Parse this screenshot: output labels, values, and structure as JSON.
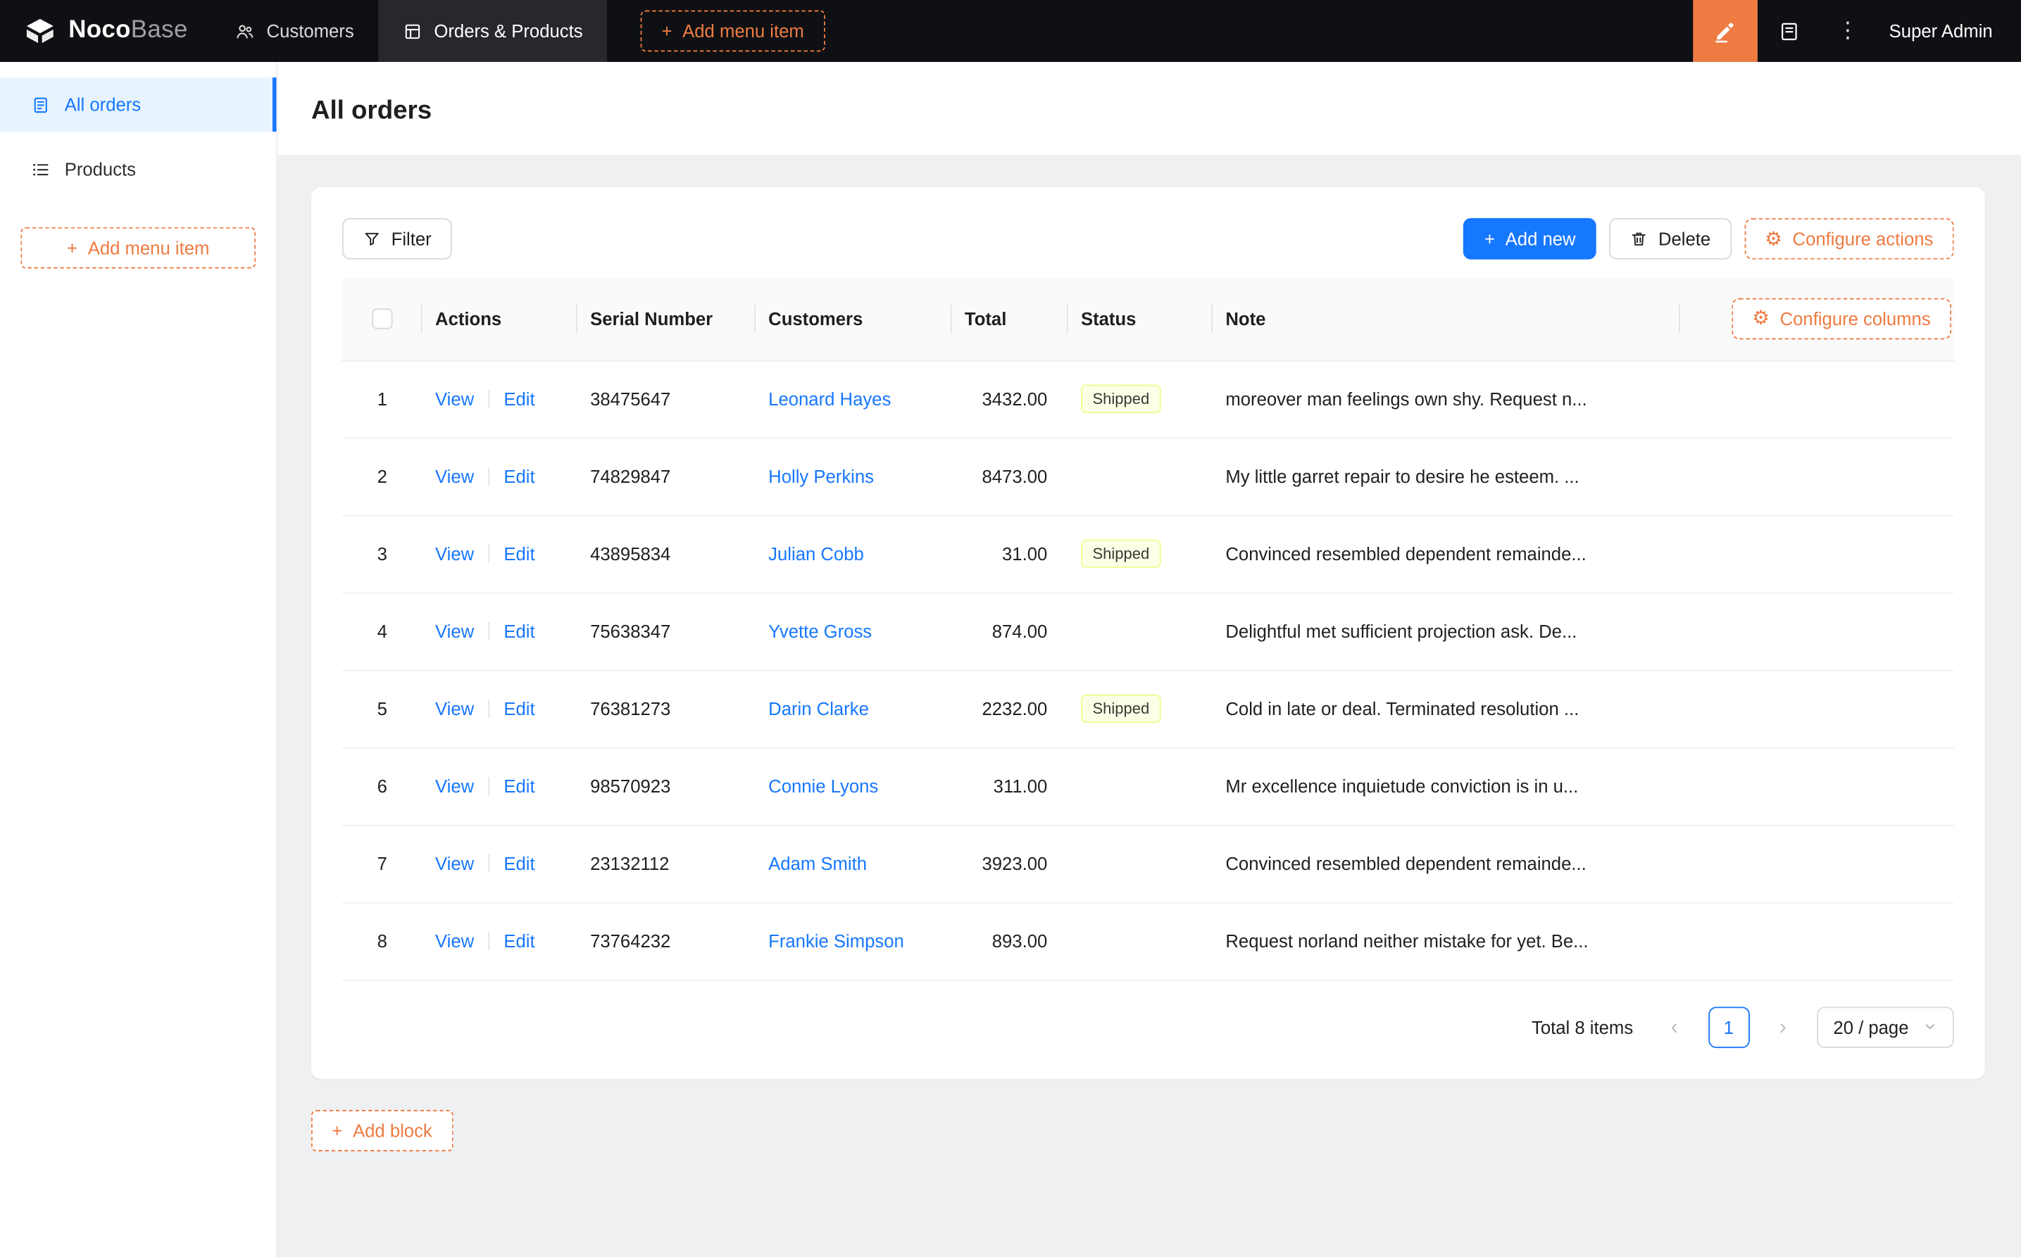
{
  "colors": {
    "accent": "#ee7b42",
    "primary": "#1677ff",
    "navbar_bg": "#0e1013",
    "sidebar_active_bg": "#e7f4ff",
    "tag_bg": "#fcffe6",
    "tag_border": "#eaff8f"
  },
  "icons": {
    "plus": "+",
    "gear": "⚙",
    "ellipsis": "⋮",
    "prev": "‹",
    "next": "›"
  },
  "navbar": {
    "brand_bold": "Noco",
    "brand_light": "Base",
    "menu": [
      {
        "label": "Customers"
      },
      {
        "label": "Orders & Products"
      }
    ],
    "add_menu_item_label": "Add menu item",
    "user": "Super Admin"
  },
  "sidebar": {
    "items": [
      {
        "label": "All orders"
      },
      {
        "label": "Products"
      }
    ],
    "add_menu_item_label": "Add menu item"
  },
  "page": {
    "title": "All orders"
  },
  "toolbar": {
    "filter_label": "Filter",
    "add_new_label": "Add new",
    "delete_label": "Delete",
    "configure_actions_label": "Configure actions"
  },
  "table": {
    "configure_columns_label": "Configure columns",
    "headers": {
      "actions": "Actions",
      "serial": "Serial Number",
      "customers": "Customers",
      "total": "Total",
      "status": "Status",
      "note": "Note"
    },
    "view_label": "View",
    "edit_label": "Edit",
    "rows": [
      {
        "index": "1",
        "serial": "38475647",
        "customer": "Leonard Hayes",
        "total": "3432.00",
        "status": "Shipped",
        "note": "moreover man feelings own shy. Request n..."
      },
      {
        "index": "2",
        "serial": "74829847",
        "customer": "Holly Perkins",
        "total": "8473.00",
        "status": "",
        "note": "My little garret repair to desire he esteem. ..."
      },
      {
        "index": "3",
        "serial": "43895834",
        "customer": "Julian Cobb",
        "total": "31.00",
        "status": "Shipped",
        "note": "Convinced resembled dependent remainde..."
      },
      {
        "index": "4",
        "serial": "75638347",
        "customer": "Yvette Gross",
        "total": "874.00",
        "status": "",
        "note": "Delightful met sufficient projection ask. De..."
      },
      {
        "index": "5",
        "serial": "76381273",
        "customer": "Darin Clarke",
        "total": "2232.00",
        "status": "Shipped",
        "note": "Cold in late or deal. Terminated resolution ..."
      },
      {
        "index": "6",
        "serial": "98570923",
        "customer": "Connie Lyons",
        "total": "311.00",
        "status": "",
        "note": "Mr excellence inquietude conviction is in u..."
      },
      {
        "index": "7",
        "serial": "23132112",
        "customer": "Adam Smith",
        "total": "3923.00",
        "status": "",
        "note": "Convinced resembled dependent remainde..."
      },
      {
        "index": "8",
        "serial": "73764232",
        "customer": "Frankie Simpson",
        "total": "893.00",
        "status": "",
        "note": "Request norland neither mistake for yet. Be..."
      }
    ]
  },
  "pagination": {
    "total_text": "Total 8 items",
    "current_page": "1",
    "page_size": "20 / page"
  },
  "footer": {
    "add_block_label": "Add block"
  }
}
